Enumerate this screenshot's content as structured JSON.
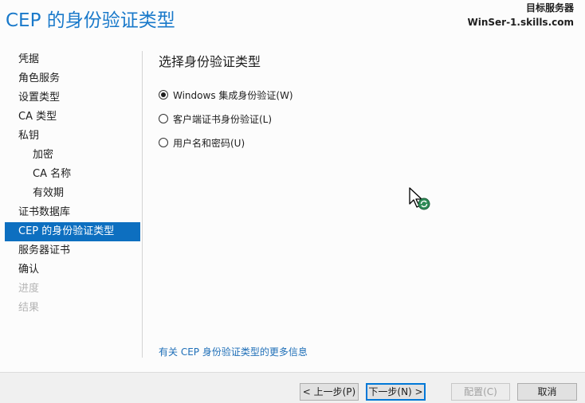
{
  "header": {
    "title": "CEP 的身份验证类型",
    "target_label": "目标服务器",
    "target_server": "WinSer-1.skills.com"
  },
  "nav": {
    "items": [
      {
        "label": "凭据",
        "state": "normal",
        "level": 0
      },
      {
        "label": "角色服务",
        "state": "normal",
        "level": 0
      },
      {
        "label": "设置类型",
        "state": "normal",
        "level": 0
      },
      {
        "label": "CA 类型",
        "state": "normal",
        "level": 0
      },
      {
        "label": "私钥",
        "state": "normal",
        "level": 0
      },
      {
        "label": "加密",
        "state": "normal",
        "level": 1
      },
      {
        "label": "CA 名称",
        "state": "normal",
        "level": 1
      },
      {
        "label": "有效期",
        "state": "normal",
        "level": 1
      },
      {
        "label": "证书数据库",
        "state": "normal",
        "level": 0
      },
      {
        "label": "CEP 的身份验证类型",
        "state": "active",
        "level": 0
      },
      {
        "label": "服务器证书",
        "state": "normal",
        "level": 0
      },
      {
        "label": "确认",
        "state": "normal",
        "level": 0
      },
      {
        "label": "进度",
        "state": "disabled",
        "level": 0
      },
      {
        "label": "结果",
        "state": "disabled",
        "level": 0
      }
    ]
  },
  "main": {
    "section_title": "选择身份验证类型",
    "options": [
      {
        "label": "Windows 集成身份验证(W)",
        "checked": true
      },
      {
        "label": "客户端证书身份验证(L)",
        "checked": false
      },
      {
        "label": "用户名和密码(U)",
        "checked": false
      }
    ],
    "more_info_link": "有关 CEP 身份验证类型的更多信息"
  },
  "footer": {
    "back_label": "< 上一步(P)",
    "next_label": "下一步(N) >",
    "configure_label": "配置(C)",
    "cancel_label": "取消"
  },
  "colors": {
    "accent": "#1979ca",
    "nav_active_bg": "#0d6fc0",
    "link": "#1f6fb8",
    "disabled_text": "#b4b4b4"
  }
}
